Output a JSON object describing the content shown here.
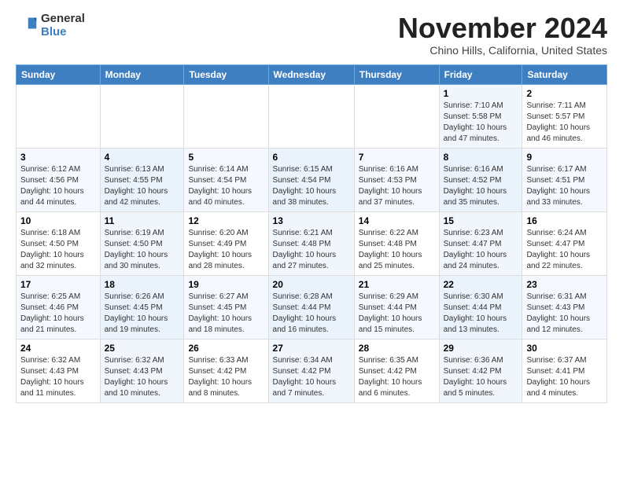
{
  "header": {
    "logo_line1": "General",
    "logo_line2": "Blue",
    "month": "November 2024",
    "location": "Chino Hills, California, United States"
  },
  "days_of_week": [
    "Sunday",
    "Monday",
    "Tuesday",
    "Wednesday",
    "Thursday",
    "Friday",
    "Saturday"
  ],
  "weeks": [
    [
      {
        "day": "",
        "info": ""
      },
      {
        "day": "",
        "info": ""
      },
      {
        "day": "",
        "info": ""
      },
      {
        "day": "",
        "info": ""
      },
      {
        "day": "",
        "info": ""
      },
      {
        "day": "1",
        "info": "Sunrise: 7:10 AM\nSunset: 5:58 PM\nDaylight: 10 hours and 47 minutes."
      },
      {
        "day": "2",
        "info": "Sunrise: 7:11 AM\nSunset: 5:57 PM\nDaylight: 10 hours and 46 minutes."
      }
    ],
    [
      {
        "day": "3",
        "info": "Sunrise: 6:12 AM\nSunset: 4:56 PM\nDaylight: 10 hours and 44 minutes."
      },
      {
        "day": "4",
        "info": "Sunrise: 6:13 AM\nSunset: 4:55 PM\nDaylight: 10 hours and 42 minutes."
      },
      {
        "day": "5",
        "info": "Sunrise: 6:14 AM\nSunset: 4:54 PM\nDaylight: 10 hours and 40 minutes."
      },
      {
        "day": "6",
        "info": "Sunrise: 6:15 AM\nSunset: 4:54 PM\nDaylight: 10 hours and 38 minutes."
      },
      {
        "day": "7",
        "info": "Sunrise: 6:16 AM\nSunset: 4:53 PM\nDaylight: 10 hours and 37 minutes."
      },
      {
        "day": "8",
        "info": "Sunrise: 6:16 AM\nSunset: 4:52 PM\nDaylight: 10 hours and 35 minutes."
      },
      {
        "day": "9",
        "info": "Sunrise: 6:17 AM\nSunset: 4:51 PM\nDaylight: 10 hours and 33 minutes."
      }
    ],
    [
      {
        "day": "10",
        "info": "Sunrise: 6:18 AM\nSunset: 4:50 PM\nDaylight: 10 hours and 32 minutes."
      },
      {
        "day": "11",
        "info": "Sunrise: 6:19 AM\nSunset: 4:50 PM\nDaylight: 10 hours and 30 minutes."
      },
      {
        "day": "12",
        "info": "Sunrise: 6:20 AM\nSunset: 4:49 PM\nDaylight: 10 hours and 28 minutes."
      },
      {
        "day": "13",
        "info": "Sunrise: 6:21 AM\nSunset: 4:48 PM\nDaylight: 10 hours and 27 minutes."
      },
      {
        "day": "14",
        "info": "Sunrise: 6:22 AM\nSunset: 4:48 PM\nDaylight: 10 hours and 25 minutes."
      },
      {
        "day": "15",
        "info": "Sunrise: 6:23 AM\nSunset: 4:47 PM\nDaylight: 10 hours and 24 minutes."
      },
      {
        "day": "16",
        "info": "Sunrise: 6:24 AM\nSunset: 4:47 PM\nDaylight: 10 hours and 22 minutes."
      }
    ],
    [
      {
        "day": "17",
        "info": "Sunrise: 6:25 AM\nSunset: 4:46 PM\nDaylight: 10 hours and 21 minutes."
      },
      {
        "day": "18",
        "info": "Sunrise: 6:26 AM\nSunset: 4:45 PM\nDaylight: 10 hours and 19 minutes."
      },
      {
        "day": "19",
        "info": "Sunrise: 6:27 AM\nSunset: 4:45 PM\nDaylight: 10 hours and 18 minutes."
      },
      {
        "day": "20",
        "info": "Sunrise: 6:28 AM\nSunset: 4:44 PM\nDaylight: 10 hours and 16 minutes."
      },
      {
        "day": "21",
        "info": "Sunrise: 6:29 AM\nSunset: 4:44 PM\nDaylight: 10 hours and 15 minutes."
      },
      {
        "day": "22",
        "info": "Sunrise: 6:30 AM\nSunset: 4:44 PM\nDaylight: 10 hours and 13 minutes."
      },
      {
        "day": "23",
        "info": "Sunrise: 6:31 AM\nSunset: 4:43 PM\nDaylight: 10 hours and 12 minutes."
      }
    ],
    [
      {
        "day": "24",
        "info": "Sunrise: 6:32 AM\nSunset: 4:43 PM\nDaylight: 10 hours and 11 minutes."
      },
      {
        "day": "25",
        "info": "Sunrise: 6:32 AM\nSunset: 4:43 PM\nDaylight: 10 hours and 10 minutes."
      },
      {
        "day": "26",
        "info": "Sunrise: 6:33 AM\nSunset: 4:42 PM\nDaylight: 10 hours and 8 minutes."
      },
      {
        "day": "27",
        "info": "Sunrise: 6:34 AM\nSunset: 4:42 PM\nDaylight: 10 hours and 7 minutes."
      },
      {
        "day": "28",
        "info": "Sunrise: 6:35 AM\nSunset: 4:42 PM\nDaylight: 10 hours and 6 minutes."
      },
      {
        "day": "29",
        "info": "Sunrise: 6:36 AM\nSunset: 4:42 PM\nDaylight: 10 hours and 5 minutes."
      },
      {
        "day": "30",
        "info": "Sunrise: 6:37 AM\nSunset: 4:41 PM\nDaylight: 10 hours and 4 minutes."
      }
    ]
  ]
}
